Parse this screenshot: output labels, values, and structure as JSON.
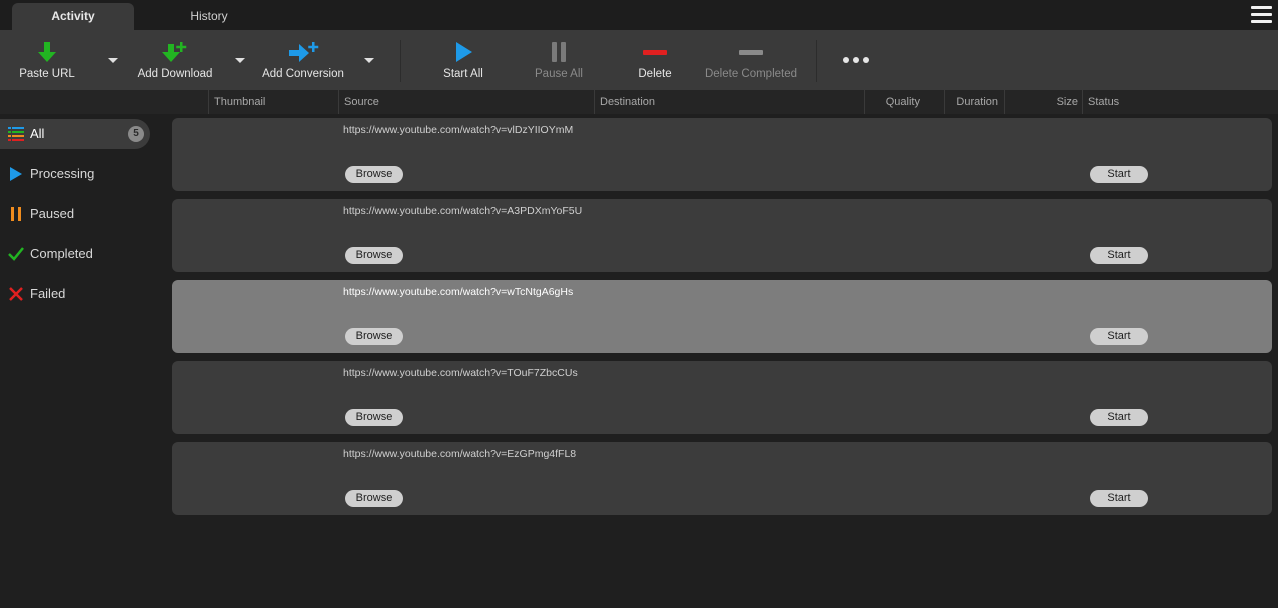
{
  "tabs": [
    {
      "label": "Activity",
      "active": true
    },
    {
      "label": "History",
      "active": false
    }
  ],
  "toolbar": {
    "paste_url": "Paste URL",
    "add_download": "Add Download",
    "add_conversion": "Add Conversion",
    "start_all": "Start All",
    "pause_all": "Pause All",
    "delete": "Delete",
    "delete_completed": "Delete Completed",
    "more": "•••"
  },
  "columns": {
    "thumbnail": "Thumbnail",
    "source": "Source",
    "destination": "Destination",
    "quality": "Quality",
    "duration": "Duration",
    "size": "Size",
    "status": "Status"
  },
  "sidebar": {
    "items": [
      {
        "label": "All",
        "count": "5",
        "icon": "list-icon"
      },
      {
        "label": "Processing",
        "icon": "play-icon"
      },
      {
        "label": "Paused",
        "icon": "pause-icon"
      },
      {
        "label": "Completed",
        "icon": "check-icon"
      },
      {
        "label": "Failed",
        "icon": "cross-icon"
      }
    ]
  },
  "rows": [
    {
      "source": "https://www.youtube.com/watch?v=vlDzYIIOYmM",
      "browse": "Browse",
      "start": "Start",
      "selected": false
    },
    {
      "source": "https://www.youtube.com/watch?v=A3PDXmYoF5U",
      "browse": "Browse",
      "start": "Start",
      "selected": false
    },
    {
      "source": "https://www.youtube.com/watch?v=wTcNtgA6gHs",
      "browse": "Browse",
      "start": "Start",
      "selected": true
    },
    {
      "source": "https://www.youtube.com/watch?v=TOuF7ZbcCUs",
      "browse": "Browse",
      "start": "Start",
      "selected": false
    },
    {
      "source": "https://www.youtube.com/watch?v=EzGPmg4fFL8",
      "browse": "Browse",
      "start": "Start",
      "selected": false
    }
  ],
  "colors": {
    "green": "#22b422",
    "blue": "#1e9ae8",
    "orange": "#f08c1e",
    "red": "#e02020",
    "grey": "#8a8a8a"
  }
}
